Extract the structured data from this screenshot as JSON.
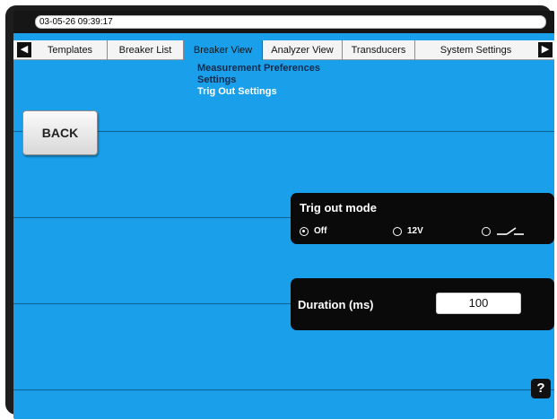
{
  "status": {
    "datetime": "03-05-26 09:39:17"
  },
  "tabs": [
    {
      "label": "Templates"
    },
    {
      "label": "Breaker List"
    },
    {
      "label": "Breaker View"
    },
    {
      "label": "Analyzer View"
    },
    {
      "label": "Transducers"
    },
    {
      "label": "System Settings"
    }
  ],
  "active_tab": "Breaker View",
  "submenu": {
    "items": [
      "Measurement Preferences",
      "Settings",
      "Trig Out Settings"
    ],
    "current": "Trig Out Settings"
  },
  "back_button": {
    "label": "BACK"
  },
  "trig_out": {
    "title": "Trig out mode",
    "options": [
      {
        "label": "Off",
        "checked": true
      },
      {
        "label": "12V",
        "checked": false
      },
      {
        "label": "",
        "checked": false,
        "icon": "contact-closure-icon"
      }
    ]
  },
  "duration": {
    "label": "Duration (ms)",
    "value": "100"
  },
  "help": {
    "label": "?"
  },
  "colors": {
    "screen_bg": "#1aa0ea",
    "panel_bg": "#0a0a0a",
    "frame": "#1d1d1d"
  }
}
